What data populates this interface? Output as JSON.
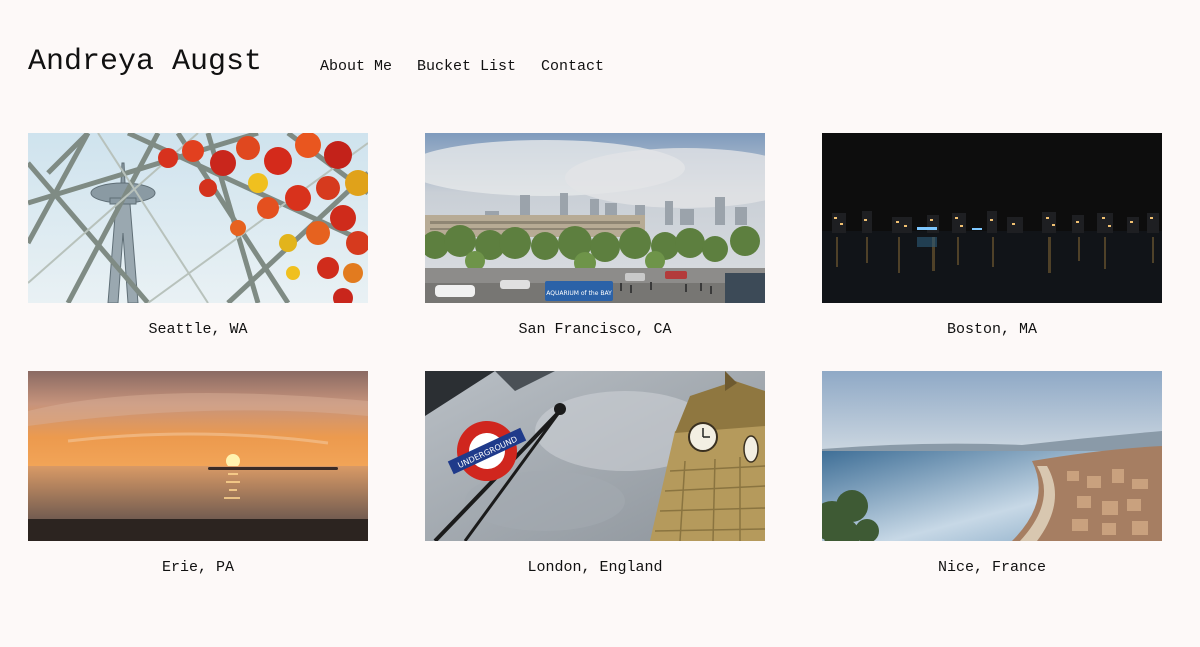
{
  "header": {
    "title": "Andreya Augst",
    "nav": [
      {
        "label": "About Me"
      },
      {
        "label": "Bucket List"
      },
      {
        "label": "Contact"
      }
    ]
  },
  "gallery": [
    {
      "caption": "Seattle, WA",
      "scene": "glass-ceiling-with-red-glass-art-and-space-needle"
    },
    {
      "caption": "San Francisco, CA",
      "scene": "city-skyline-with-street-and-trees"
    },
    {
      "caption": "Boston, MA",
      "scene": "night-city-lights-over-water"
    },
    {
      "caption": "Erie, PA",
      "scene": "sunset-over-lake"
    },
    {
      "caption": "London, England",
      "scene": "big-ben-and-underground-sign"
    },
    {
      "caption": "Nice, France",
      "scene": "coastline-bay-with-city"
    }
  ],
  "photo_texts": {
    "aquarium_sign": "AQUARIUM of the BAY",
    "underground_sign": "UNDERGROUND"
  }
}
